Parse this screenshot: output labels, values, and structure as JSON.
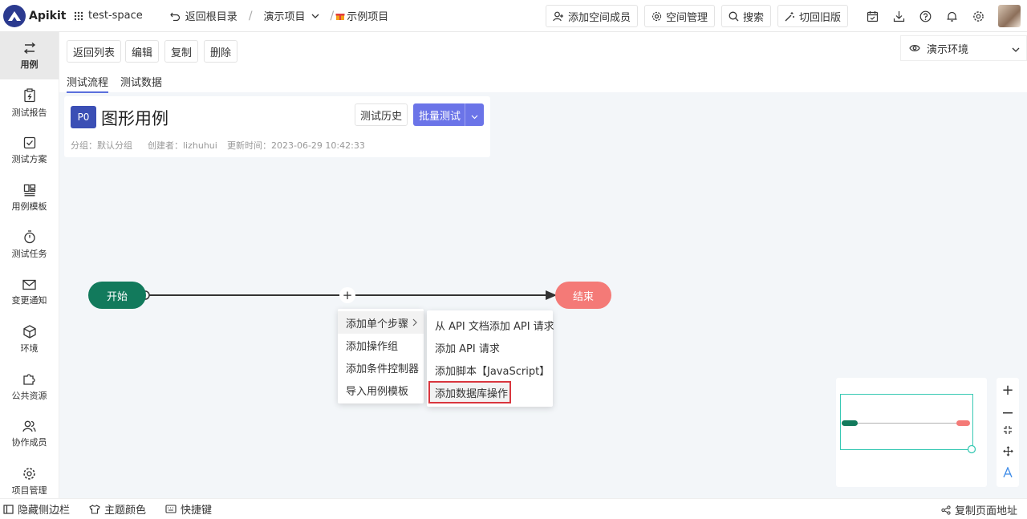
{
  "app": {
    "name": "Apikit"
  },
  "breadcrumb": {
    "space": "test-space",
    "back_root": "返回根目录",
    "project": "演示项目",
    "sample_project": "示例项目"
  },
  "toolbar": {
    "add_member": "添加空间成员",
    "space_manage": "空间管理",
    "search": "搜索",
    "switch_old": "切回旧版"
  },
  "sidebar": {
    "items": [
      {
        "label": "用例",
        "icon": "case-icon"
      },
      {
        "label": "测试报告",
        "icon": "report-icon"
      },
      {
        "label": "测试方案",
        "icon": "plan-icon"
      },
      {
        "label": "用例模板",
        "icon": "template-icon"
      },
      {
        "label": "测试任务",
        "icon": "timer-icon"
      },
      {
        "label": "变更通知",
        "icon": "mail-icon"
      },
      {
        "label": "环境",
        "icon": "cube-icon"
      },
      {
        "label": "公共资源",
        "icon": "puzzle-icon"
      },
      {
        "label": "协作成员",
        "icon": "members-icon"
      },
      {
        "label": "项目管理",
        "icon": "gear-icon"
      }
    ]
  },
  "actions": {
    "back_list": "返回列表",
    "edit": "编辑",
    "copy": "复制",
    "delete": "删除"
  },
  "tabs": {
    "flow": "测试流程",
    "data": "测试数据"
  },
  "environment": {
    "selected": "演示环境"
  },
  "case": {
    "priority": "P0",
    "title": "图形用例",
    "history": "测试历史",
    "batch_test": "批量测试",
    "group": "分组：默认分组",
    "creator": "创建者：lizhuhui",
    "updated": "更新时间：2023-06-29 10:42:33"
  },
  "flow": {
    "start": "开始",
    "end": "结束"
  },
  "menu": {
    "main": [
      "添加单个步骤",
      "添加操作组",
      "添加条件控制器",
      "导入用例模板"
    ],
    "sub": [
      "从 API 文档添加 API 请求",
      "添加 API 请求",
      "添加脚本【JavaScript】",
      "添加数据库操作"
    ]
  },
  "bottom": {
    "hide_sidebar": "隐藏侧边栏",
    "theme": "主题颜色",
    "shortcuts": "快捷键",
    "copy_url": "复制页面地址"
  },
  "colors": {
    "accent": "#6b74e8",
    "start": "#127a5c",
    "end": "#f47a77",
    "brand": "#2b3a8f",
    "highlight": "#d9363e"
  }
}
